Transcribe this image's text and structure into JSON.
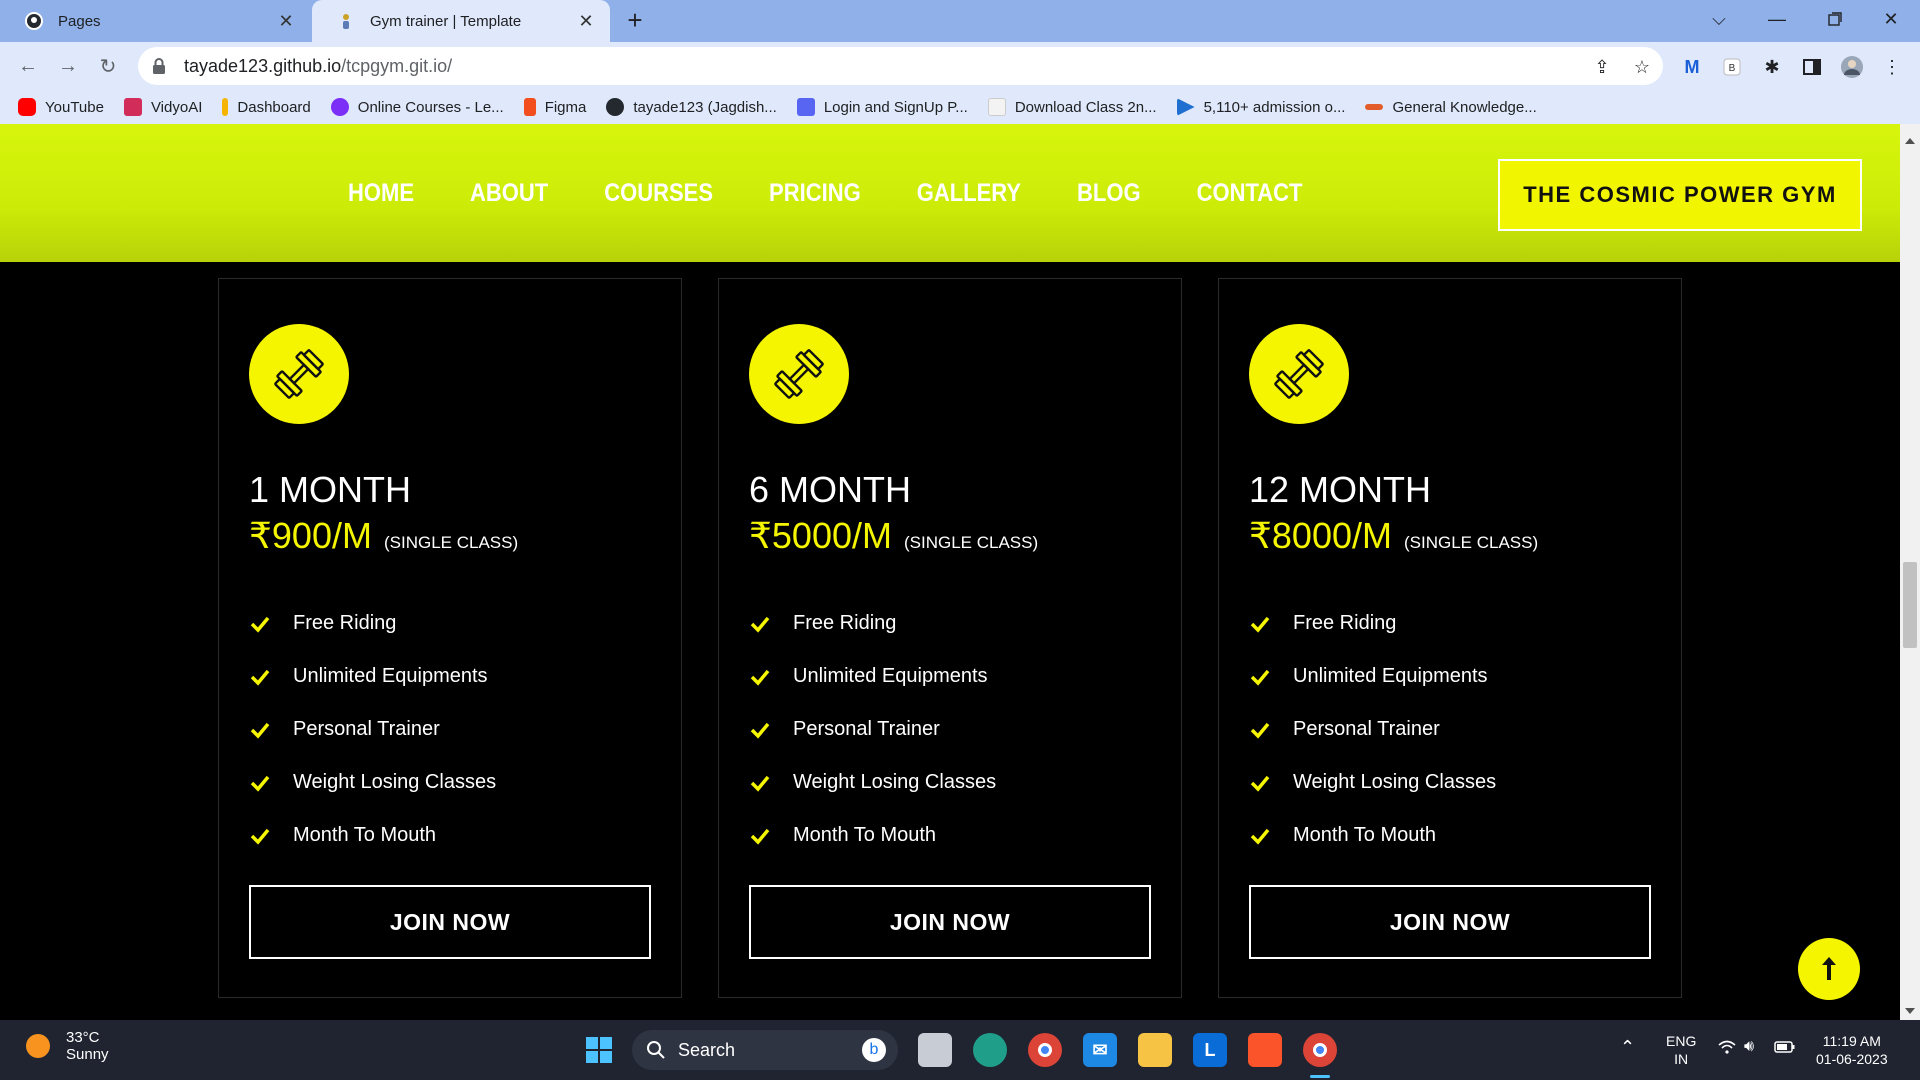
{
  "browser": {
    "tabs": [
      {
        "title": "Pages"
      },
      {
        "title": "Gym trainer | Template"
      }
    ],
    "url_host": "tayade123.github.io",
    "url_path": "/tcpgym.git.io/",
    "bookmarks": [
      {
        "label": "YouTube",
        "color": "#ff0000"
      },
      {
        "label": "VidyoAI",
        "color": "#d22c5a"
      },
      {
        "label": "Dashboard",
        "color": "#f4b400"
      },
      {
        "label": "Online Courses - Le...",
        "color": "#7b2ff7"
      },
      {
        "label": "Figma",
        "color": "#f24e1e"
      },
      {
        "label": "tayade123 (Jagdish...",
        "color": "#24292f"
      },
      {
        "label": "Login and SignUp P...",
        "color": "#5865f2"
      },
      {
        "label": "Download Class 2n...",
        "color": "#e7e7e7"
      },
      {
        "label": "5,110+ admission o...",
        "color": "#1f6fd1"
      },
      {
        "label": "General Knowledge...",
        "color": "#e35d2c"
      }
    ]
  },
  "site": {
    "nav": [
      "HOME",
      "ABOUT",
      "COURSES",
      "PRICING",
      "GALLERY",
      "BLOG",
      "CONTACT"
    ],
    "brand": "THE COSMIC POWER GYM",
    "accent": "#f5f500",
    "plans": [
      {
        "name": "1 MONTH",
        "price": "₹900/M",
        "note": "(SINGLE CLASS)",
        "features": [
          "Free Riding",
          "Unlimited Equipments",
          "Personal Trainer",
          "Weight Losing Classes",
          "Month To Mouth"
        ],
        "cta": "JOIN NOW"
      },
      {
        "name": "6 MONTH",
        "price": "₹5000/M",
        "note": "(SINGLE CLASS)",
        "features": [
          "Free Riding",
          "Unlimited Equipments",
          "Personal Trainer",
          "Weight Losing Classes",
          "Month To Mouth"
        ],
        "cta": "JOIN NOW"
      },
      {
        "name": "12 MONTH",
        "price": "₹8000/M",
        "note": "(SINGLE CLASS)",
        "features": [
          "Free Riding",
          "Unlimited Equipments",
          "Personal Trainer",
          "Weight Losing Classes",
          "Month To Mouth"
        ],
        "cta": "JOIN NOW"
      }
    ]
  },
  "taskbar": {
    "temperature": "33°C",
    "condition": "Sunny",
    "search_label": "Search",
    "lang_top": "ENG",
    "lang_bottom": "IN",
    "time": "11:19 AM",
    "date": "01-06-2023"
  }
}
